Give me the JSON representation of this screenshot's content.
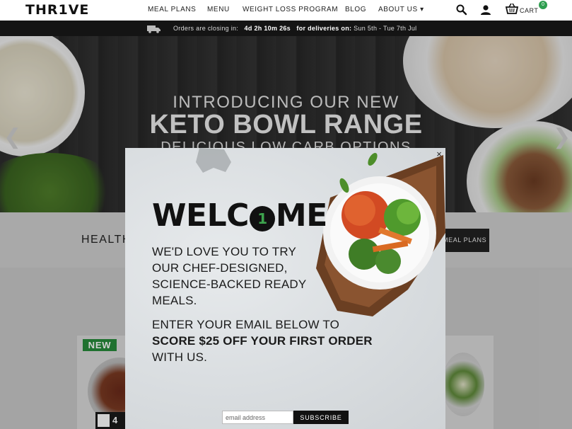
{
  "header": {
    "logo": "THR1VE",
    "nav": [
      "MEAL PLANS",
      "MENU",
      "WEIGHT LOSS PROGRAM",
      "BLOG",
      "ABOUT US ▾"
    ],
    "cart_label": "CART",
    "cart_count": "0",
    "icons": [
      "search-icon",
      "user-icon",
      "cart-icon"
    ]
  },
  "delivery_bar": {
    "prefix": "Orders are closing in:",
    "countdown": "4d 2h 10m 26s",
    "deliveries_label": "for deliveries on:",
    "dates": "Sun 5th - Tue 7th Jul"
  },
  "hero": {
    "line1": "INTRODUCING OUR NEW",
    "line2": "KETO BOWL RANGE",
    "line3": "DELICIOUS LOW CARB OPTIONS"
  },
  "band": {
    "text": "HEALTH",
    "button": "MEAL PLANS"
  },
  "product": {
    "badge": "NEW",
    "rating": "4"
  },
  "modal": {
    "welcome_pre": "WELC",
    "welcome_mark": "1",
    "welcome_post": "ME",
    "intro": "WE'D LOVE YOU TO TRY OUR CHEF-DESIGNED, SCIENCE-BACKED READY MEALS.",
    "offer_pre": "ENTER YOUR EMAIL BELOW TO",
    "offer_bold": "SCORE $25 OFF YOUR FIRST ORDER",
    "offer_post": "WITH US.",
    "email_placeholder": "email address",
    "subscribe": "SUBSCRIBE",
    "close": "×"
  },
  "colors": {
    "accent_green": "#2e9e4f",
    "bar_bg": "#141414"
  }
}
